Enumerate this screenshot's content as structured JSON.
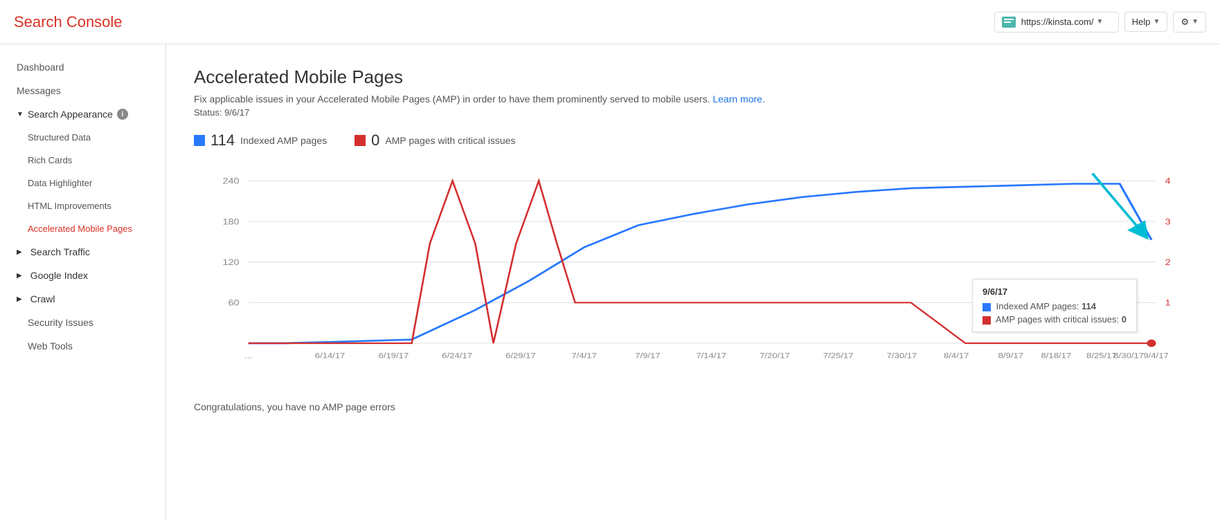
{
  "header": {
    "title": "Search Console",
    "site": "https://kinsta.com/",
    "help_label": "Help",
    "gear_icon": "⚙"
  },
  "sidebar": {
    "dashboard": "Dashboard",
    "messages": "Messages",
    "search_appearance": {
      "label": "Search Appearance",
      "items": [
        {
          "label": "Structured Data",
          "active": false
        },
        {
          "label": "Rich Cards",
          "active": false
        },
        {
          "label": "Data Highlighter",
          "active": false
        },
        {
          "label": "HTML Improvements",
          "active": false
        },
        {
          "label": "Accelerated Mobile Pages",
          "active": true
        }
      ]
    },
    "search_traffic": "Search Traffic",
    "google_index": "Google Index",
    "crawl": "Crawl",
    "security_issues": "Security Issues",
    "web_tools": "Web Tools"
  },
  "main": {
    "title": "Accelerated Mobile Pages",
    "description": "Fix applicable issues in your Accelerated Mobile Pages (AMP) in order to have them prominently served to mobile users.",
    "learn_more": "Learn more.",
    "status": "Status: 9/6/17",
    "indexed_count": "114",
    "indexed_label": "Indexed AMP pages",
    "critical_count": "0",
    "critical_label": "AMP pages with critical issues",
    "success_msg": "Congratulations, you have no AMP page errors"
  },
  "tooltip": {
    "date": "9/6/17",
    "line1_label": "Indexed AMP pages:",
    "line1_value": "114",
    "line2_label": "AMP pages with critical issues:",
    "line2_value": "0"
  },
  "chart": {
    "x_labels": [
      "...",
      "6/14/17",
      "6/19/17",
      "6/24/17",
      "6/29/17",
      "7/4/17",
      "7/9/17",
      "7/14/17",
      "7/20/17",
      "7/25/17",
      "7/30/17",
      "8/4/17",
      "8/9/17",
      "8/18/17",
      "8/25/17",
      "8/30/17",
      "9/4/17"
    ],
    "y_labels_left": [
      "60",
      "120",
      "180",
      "240"
    ],
    "y_labels_right": [
      "1",
      "2",
      "3",
      "4"
    ],
    "colors": {
      "blue": "#2979ff",
      "red": "#d32f2f",
      "teal_arrow": "#00bcd4"
    }
  }
}
